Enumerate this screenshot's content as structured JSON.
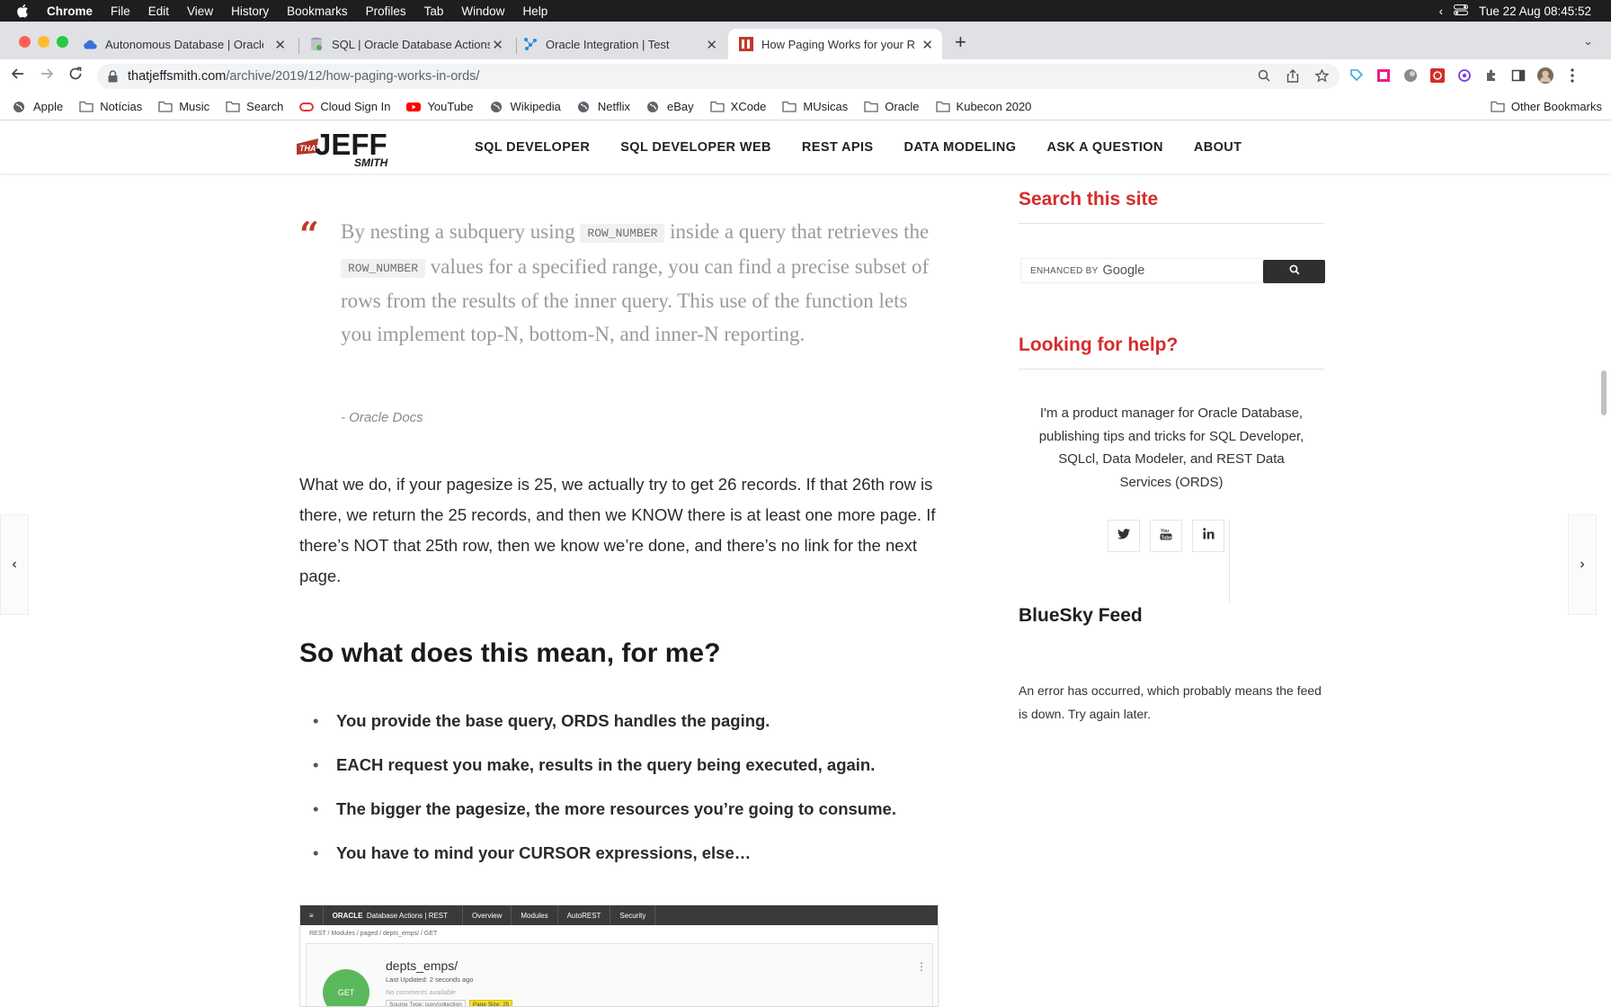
{
  "menubar": {
    "app": "Chrome",
    "items": [
      "File",
      "Edit",
      "View",
      "History",
      "Bookmarks",
      "Profiles",
      "Tab",
      "Window",
      "Help"
    ],
    "datetime": "Tue 22 Aug  08:45:52"
  },
  "tabs": [
    {
      "title": "Autonomous Database | Oracle",
      "icon": "cloud-icon"
    },
    {
      "title": "SQL | Oracle Database Actions",
      "icon": "oracle-db-icon"
    },
    {
      "title": "Oracle Integration | Test",
      "icon": "integration-icon"
    },
    {
      "title": "How Paging Works for your REST",
      "icon": "thatjeffsmith-icon",
      "active": true
    }
  ],
  "toolbar": {
    "url_host": "thatjeffsmith.com",
    "url_path": "/archive/2019/12/how-paging-works-in-ords/"
  },
  "bookmarks": [
    {
      "label": "Apple",
      "icon": "globe-icon"
    },
    {
      "label": "Notícias",
      "icon": "folder-icon"
    },
    {
      "label": "Music",
      "icon": "folder-icon"
    },
    {
      "label": "Search",
      "icon": "folder-icon"
    },
    {
      "label": "Cloud Sign In",
      "icon": "oracle-ring-icon"
    },
    {
      "label": "YouTube",
      "icon": "youtube-icon"
    },
    {
      "label": "Wikipedia",
      "icon": "globe-icon"
    },
    {
      "label": "Netflix",
      "icon": "globe-icon"
    },
    {
      "label": "eBay",
      "icon": "globe-icon"
    },
    {
      "label": "XCode",
      "icon": "folder-icon"
    },
    {
      "label": "MUsicas",
      "icon": "folder-icon"
    },
    {
      "label": "Oracle",
      "icon": "folder-icon"
    },
    {
      "label": "Kubecon 2020",
      "icon": "folder-icon"
    }
  ],
  "other_bookmarks": "Other Bookmarks",
  "site": {
    "logo_that": "THAT",
    "logo_jeff": "JEFF",
    "logo_smith": "SMITH",
    "nav": [
      "SQL DEVELOPER",
      "SQL DEVELOPER WEB",
      "REST APIS",
      "DATA MODELING",
      "ASK A QUESTION",
      "ABOUT"
    ]
  },
  "article": {
    "quote": {
      "part1": "By nesting a subquery using",
      "code1": "ROW_NUMBER",
      "part2": "inside a query that retrieves the",
      "code2": "ROW_NUMBER",
      "part3": "values for a specified range, you can find a precise subset of rows from the results of the inner query. This use of the function lets you implement top-N, bottom-N, and inner-N reporting.",
      "cite": "-  Oracle Docs"
    },
    "paragraph": "What we do, if your pagesize is 25, we actually try to get 26 records. If that 26th row is there, we return the 25 records, and then we KNOW there is at least one more page. If there’s NOT that 25th row, then we know we’re done, and there’s no link for the next page.",
    "heading": "So what does this mean, for me?",
    "bullets": [
      "You provide the base query, ORDS handles the paging.",
      "EACH request you make, results in the query being executed, again.",
      "The bigger the pagesize, the more resources you’re going to consume.",
      "You have to mind your CURSOR expressions, else…"
    ],
    "screenshot": {
      "brand": "ORACLE",
      "app": "Database Actions | REST",
      "tabs": [
        "Overview",
        "Modules",
        "AutoREST",
        "Security"
      ],
      "breadcrumb": "REST  /  Modules  /  paged  /  depts_emps/  /  GET",
      "method": "GET",
      "title": "depts_emps/",
      "updated": "Last Updated: 2 seconds ago",
      "comments": "No comments available",
      "tag1": "Source Type: json/collection",
      "tag2": "Page Size: 25"
    }
  },
  "sidebar": {
    "search_title": "Search this site",
    "search_enhanced": "ENHANCED BY",
    "search_google": "Google",
    "help_title": "Looking for help?",
    "help_text": "I'm a product manager for Oracle Database, publishing tips and tricks for SQL Developer, SQLcl, Data Modeler, and REST Data Services (ORDS)",
    "bluesky_title": "BlueSky Feed",
    "bluesky_error": "An error has occurred, which probably means the feed is down. Try again later."
  },
  "colors": {
    "accent_red": "#d62c2c",
    "menubar": "#1e1e1e",
    "tabstrip": "#dfe1e5"
  }
}
